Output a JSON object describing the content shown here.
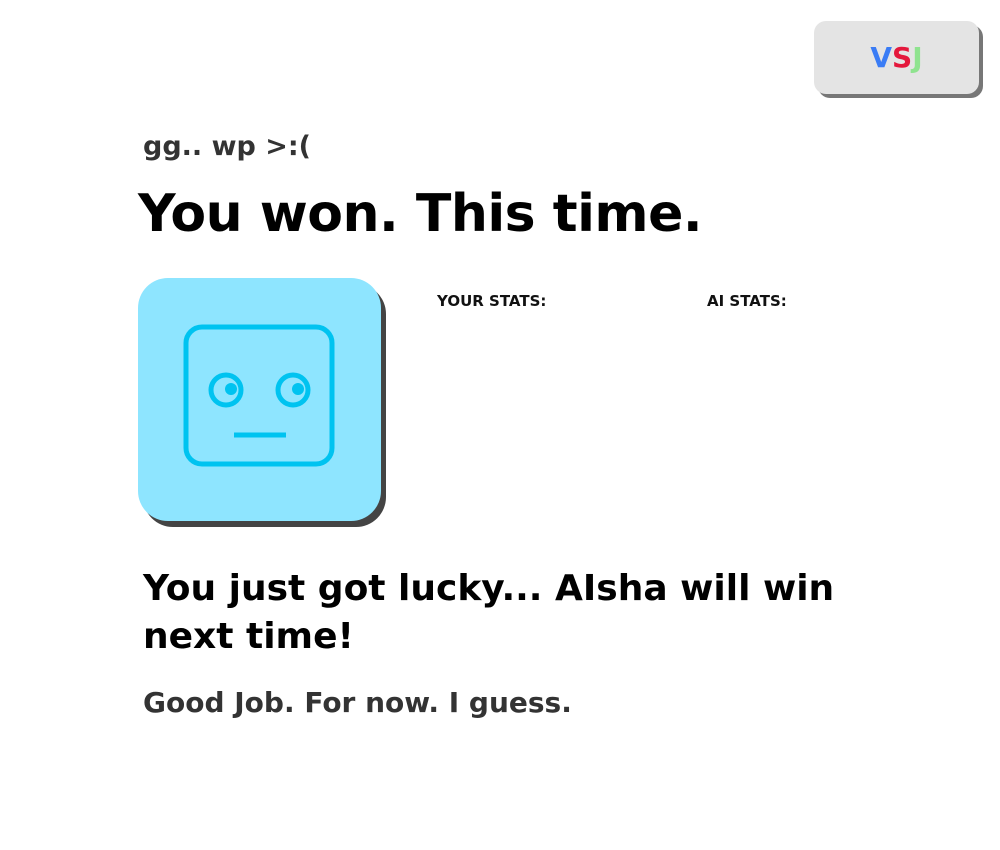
{
  "header": {
    "logo": {
      "letters": [
        {
          "char": "V",
          "color": "#3a7cf5"
        },
        {
          "char": "S",
          "color": "#e4183c"
        },
        {
          "char": "J",
          "color": "#8fe38f"
        }
      ],
      "background": "#e4e4e4"
    }
  },
  "result": {
    "subtitle": "gg.. wp >:(",
    "title": "You won. This time."
  },
  "avatar": {
    "icon": "robot-face-icon",
    "background": "#8ee5ff",
    "stroke": "#00c3f0"
  },
  "stats": {
    "your_label": "YOUR STATS:",
    "ai_label": "AI STATS:"
  },
  "message": {
    "main": "You just got lucky... AIsha will win next time!",
    "secondary": "Good Job. For now. I guess."
  }
}
